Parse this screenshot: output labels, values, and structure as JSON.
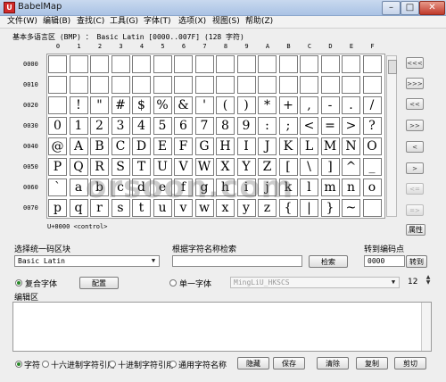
{
  "window": {
    "title": "BabelMap",
    "app_icon": "U",
    "min_icon": "–",
    "max_icon": "□",
    "close_icon": "✕"
  },
  "menu": [
    "文件(W)",
    "编辑(B)",
    "查找(C)",
    "工具(G)",
    "字体(T)",
    "选项(X)",
    "视图(S)",
    "帮助(Z)"
  ],
  "block_header": "基本多语言区 (BMP) ： Basic Latin [0000..007F] (128 字符)",
  "col_headers": [
    "0",
    "1",
    "2",
    "3",
    "4",
    "5",
    "6",
    "7",
    "8",
    "9",
    "A",
    "B",
    "C",
    "D",
    "E",
    "F"
  ],
  "row_headers": [
    "0000",
    "0010",
    "0020",
    "0030",
    "0040",
    "0050",
    "0060",
    "0070"
  ],
  "grid_rows": [
    [
      "",
      "",
      "",
      "",
      "",
      "",
      "",
      "",
      "",
      "",
      "",
      "",
      "",
      "",
      "",
      ""
    ],
    [
      "",
      "",
      "",
      "",
      "",
      "",
      "",
      "",
      "",
      "",
      "",
      "",
      "",
      "",
      "",
      ""
    ],
    [
      "",
      "!",
      "\"",
      "#",
      "$",
      "%",
      "&",
      "'",
      "(",
      ")",
      "*",
      "+",
      ",",
      "-",
      ".",
      "/"
    ],
    [
      "0",
      "1",
      "2",
      "3",
      "4",
      "5",
      "6",
      "7",
      "8",
      "9",
      ":",
      ";",
      "<",
      "=",
      ">",
      "?"
    ],
    [
      "@",
      "A",
      "B",
      "C",
      "D",
      "E",
      "F",
      "G",
      "H",
      "I",
      "J",
      "K",
      "L",
      "M",
      "N",
      "O"
    ],
    [
      "P",
      "Q",
      "R",
      "S",
      "T",
      "U",
      "V",
      "W",
      "X",
      "Y",
      "Z",
      "[",
      "\\",
      "]",
      "^",
      "_"
    ],
    [
      "`",
      "a",
      "b",
      "c",
      "d",
      "e",
      "f",
      "g",
      "h",
      "i",
      "j",
      "k",
      "l",
      "m",
      "n",
      "o"
    ],
    [
      "p",
      "q",
      "r",
      "s",
      "t",
      "u",
      "v",
      "w",
      "x",
      "y",
      "z",
      "{",
      "|",
      "}",
      "~",
      ""
    ]
  ],
  "nav_buttons": [
    "<<<",
    ">>>",
    "<<",
    ">>",
    "<",
    ">",
    "<=",
    "=>"
  ],
  "status_line": "U+0000 <control>",
  "props_button": "属性",
  "block_select": {
    "label": "选择统一码区块",
    "value": "Basic Latin"
  },
  "name_search": {
    "label": "根据字符名称检索",
    "value": "",
    "button": "检索"
  },
  "goto": {
    "label": "转到编码点",
    "value": "0000",
    "button": "转到"
  },
  "font": {
    "composite_label": "复合字体",
    "config_button": "配置",
    "single_label": "单一字体",
    "single_value": "MingLiU_HKSCS",
    "size": "12",
    "spin_up": "▲",
    "spin_down": "▼"
  },
  "edit_area_label": "编辑区",
  "bottom": {
    "radios": [
      "字符",
      "十六进制字符引用",
      "十进制字符引用",
      "通用字符名称"
    ],
    "buttons": [
      "隐藏",
      "保存",
      "清除",
      "复制",
      "剪切"
    ]
  },
  "watermark": "orsoon.com",
  "select_arrow": "▼"
}
